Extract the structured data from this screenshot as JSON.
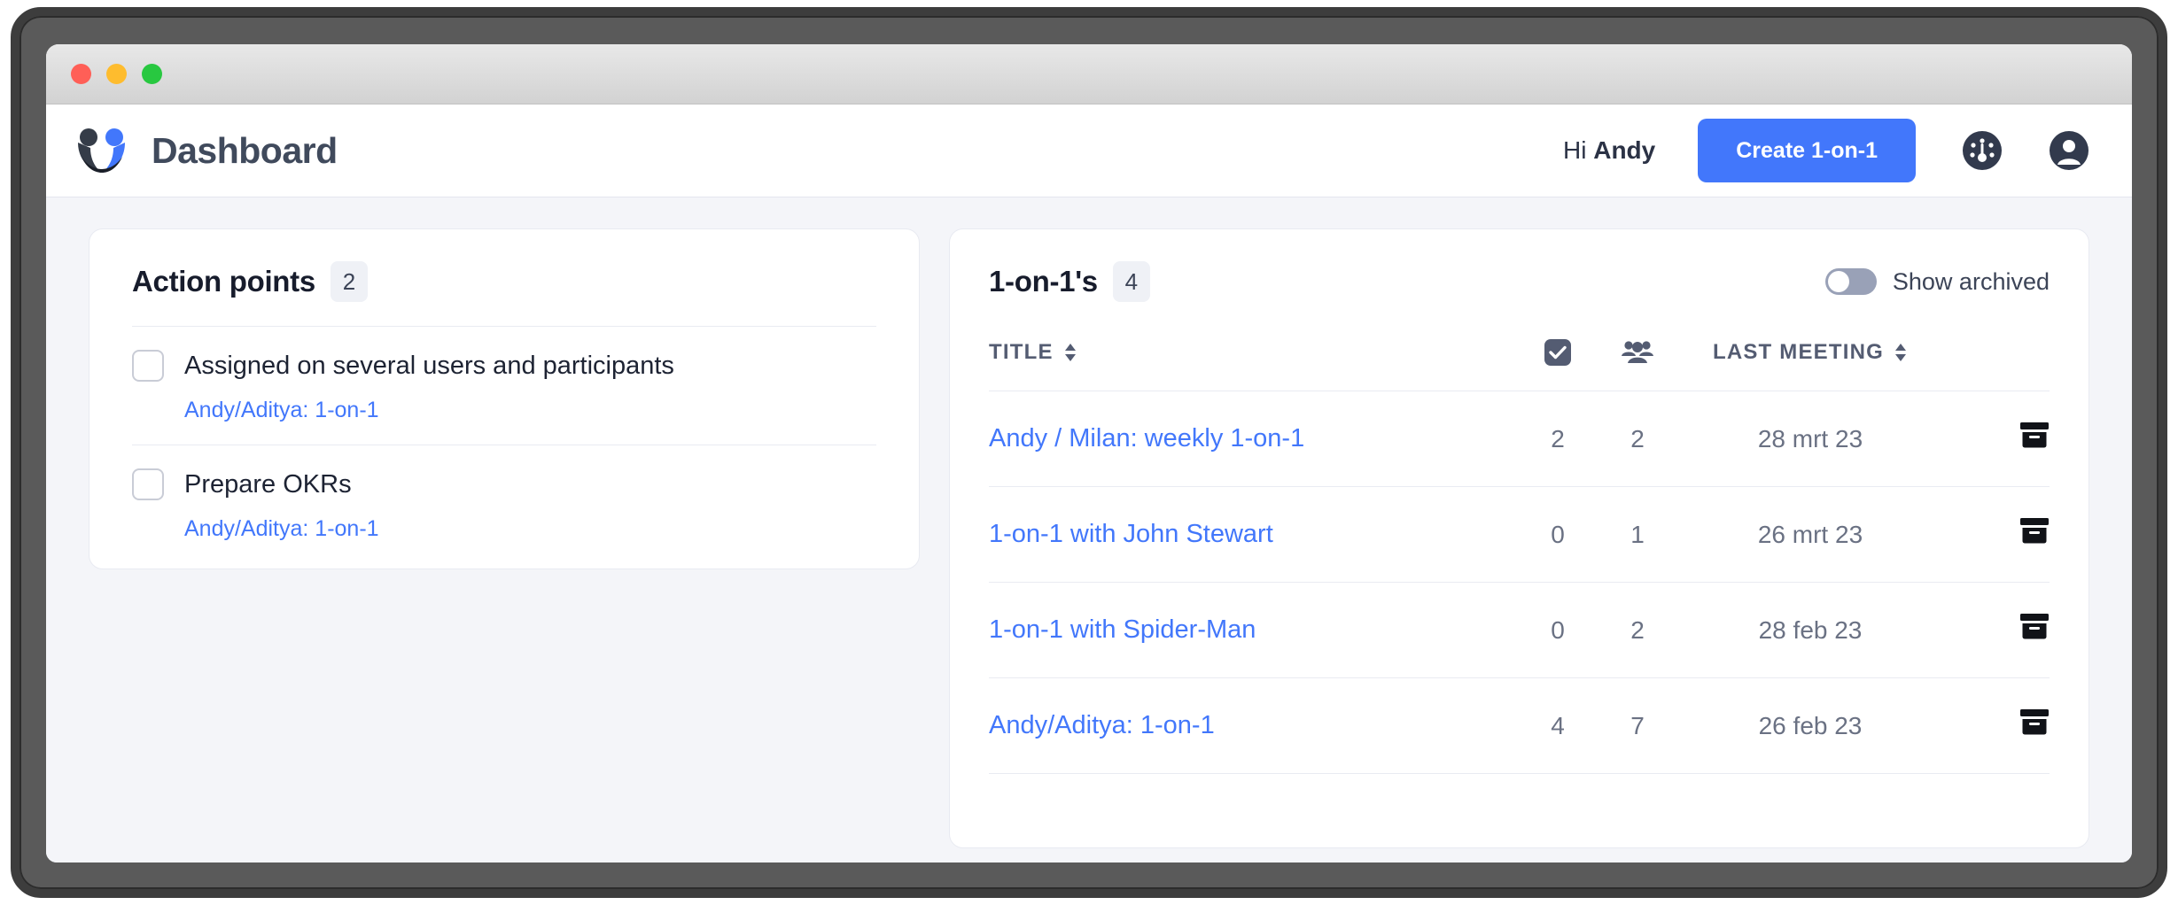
{
  "window": {
    "traffic_lights": [
      "close",
      "minimize",
      "zoom"
    ]
  },
  "header": {
    "logo_icon": "smiley-people-logo",
    "title": "Dashboard",
    "greeting_prefix": "Hi ",
    "greeting_name": "Andy",
    "create_button": "Create 1-on-1",
    "gauge_icon": "gauge-icon",
    "account_icon": "account-icon",
    "accent_color": "#4277fb"
  },
  "action_points": {
    "title": "Action points",
    "count": "2",
    "items": [
      {
        "label": "Assigned on several users and participants",
        "link": "Andy/Aditya: 1-on-1",
        "checked": false
      },
      {
        "label": "Prepare OKRs",
        "link": "Andy/Aditya: 1-on-1",
        "checked": false
      }
    ]
  },
  "one_on_ones": {
    "title": "1-on-1's",
    "count": "4",
    "show_archived_label": "Show archived",
    "show_archived_on": false,
    "columns": {
      "title": "TITLE",
      "action_points_icon": "checkbox-checked-icon",
      "participants_icon": "people-group-icon",
      "last_meeting": "LAST MEETING",
      "archive_icon": "archive-icon",
      "sort_icon": "sort-updown-icon"
    },
    "rows": [
      {
        "title": "Andy / Milan: weekly 1-on-1",
        "action_points": "2",
        "participants": "2",
        "last_meeting": "28 mrt 23"
      },
      {
        "title": "1-on-1 with John Stewart",
        "action_points": "0",
        "participants": "1",
        "last_meeting": "26 mrt 23"
      },
      {
        "title": "1-on-1 with Spider-Man",
        "action_points": "0",
        "participants": "2",
        "last_meeting": "28 feb 23"
      },
      {
        "title": "Andy/Aditya: 1-on-1",
        "action_points": "4",
        "participants": "7",
        "last_meeting": "26 feb 23"
      }
    ]
  }
}
